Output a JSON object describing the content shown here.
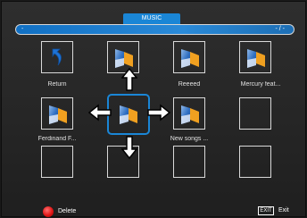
{
  "header": {
    "title": "MUSIC",
    "progress_left": "-",
    "progress_right": "- / -"
  },
  "grid": {
    "items": [
      {
        "label": "Return",
        "icon": "return-icon"
      },
      {
        "label": "",
        "icon": "folder-icon"
      },
      {
        "label": "Reeeed",
        "icon": "folder-icon"
      },
      {
        "label": "Mercury feat...",
        "icon": "folder-icon"
      },
      {
        "label": "Ferdinand F...",
        "icon": "folder-icon"
      },
      {
        "label": "",
        "icon": "folder-icon"
      },
      {
        "label": "New songs ...",
        "icon": "folder-icon"
      },
      {
        "label": "",
        "icon": ""
      },
      {
        "label": "",
        "icon": ""
      },
      {
        "label": "",
        "icon": ""
      },
      {
        "label": "",
        "icon": ""
      },
      {
        "label": "",
        "icon": ""
      }
    ]
  },
  "footer": {
    "delete_label": "Delete",
    "exit_key": "EXIT",
    "exit_label": "Exit"
  },
  "colors": {
    "accent": "#1a86d6",
    "delete_red": "#e01616"
  }
}
